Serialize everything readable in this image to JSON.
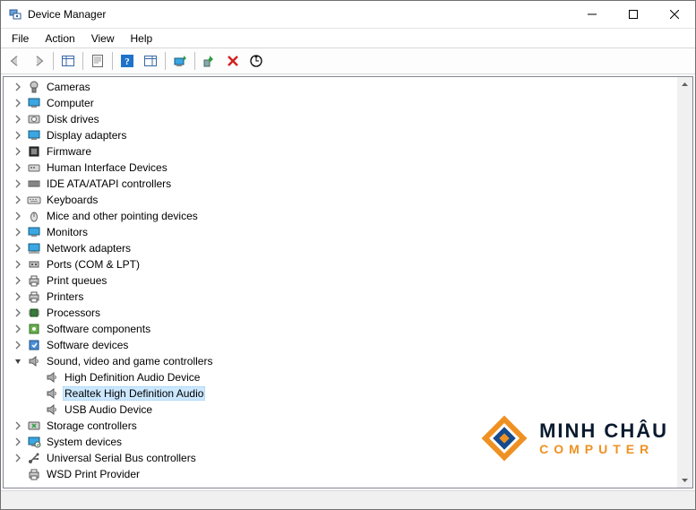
{
  "title": "Device Manager",
  "menu": [
    "File",
    "Action",
    "View",
    "Help"
  ],
  "watermark": {
    "top": "MINH CHÂU",
    "bot": "COMPUTER"
  },
  "tree": [
    {
      "label": "Cameras",
      "icon": "camera",
      "lvl": 1,
      "exp": ">"
    },
    {
      "label": "Computer",
      "icon": "monitor",
      "lvl": 1,
      "exp": ">"
    },
    {
      "label": "Disk drives",
      "icon": "disk",
      "lvl": 1,
      "exp": ">"
    },
    {
      "label": "Display adapters",
      "icon": "monitor",
      "lvl": 1,
      "exp": ">"
    },
    {
      "label": "Firmware",
      "icon": "chip",
      "lvl": 1,
      "exp": ">"
    },
    {
      "label": "Human Interface Devices",
      "icon": "hid",
      "lvl": 1,
      "exp": ">"
    },
    {
      "label": "IDE ATA/ATAPI controllers",
      "icon": "ide",
      "lvl": 1,
      "exp": ">"
    },
    {
      "label": "Keyboards",
      "icon": "keyboard",
      "lvl": 1,
      "exp": ">"
    },
    {
      "label": "Mice and other pointing devices",
      "icon": "mouse",
      "lvl": 1,
      "exp": ">"
    },
    {
      "label": "Monitors",
      "icon": "monitor",
      "lvl": 1,
      "exp": ">"
    },
    {
      "label": "Network adapters",
      "icon": "network",
      "lvl": 1,
      "exp": ">"
    },
    {
      "label": "Ports (COM & LPT)",
      "icon": "port",
      "lvl": 1,
      "exp": ">"
    },
    {
      "label": "Print queues",
      "icon": "printer",
      "lvl": 1,
      "exp": ">"
    },
    {
      "label": "Printers",
      "icon": "printer",
      "lvl": 1,
      "exp": ">"
    },
    {
      "label": "Processors",
      "icon": "cpu",
      "lvl": 1,
      "exp": ">"
    },
    {
      "label": "Software components",
      "icon": "swc",
      "lvl": 1,
      "exp": ">"
    },
    {
      "label": "Software devices",
      "icon": "swd",
      "lvl": 1,
      "exp": ">"
    },
    {
      "label": "Sound, video and game controllers",
      "icon": "speaker",
      "lvl": 1,
      "exp": "v"
    },
    {
      "label": "High Definition Audio Device",
      "icon": "speaker",
      "lvl": 2,
      "exp": " "
    },
    {
      "label": "Realtek High Definition Audio",
      "icon": "speaker",
      "lvl": 2,
      "exp": " ",
      "selected": true
    },
    {
      "label": "USB Audio Device",
      "icon": "speaker",
      "lvl": 2,
      "exp": " "
    },
    {
      "label": "Storage controllers",
      "icon": "storage",
      "lvl": 1,
      "exp": ">"
    },
    {
      "label": "System devices",
      "icon": "system",
      "lvl": 1,
      "exp": ">"
    },
    {
      "label": "Universal Serial Bus controllers",
      "icon": "usb",
      "lvl": 1,
      "exp": ">"
    },
    {
      "label": "WSD Print Provider",
      "icon": "printer",
      "lvl": 1,
      "exp": " "
    }
  ]
}
